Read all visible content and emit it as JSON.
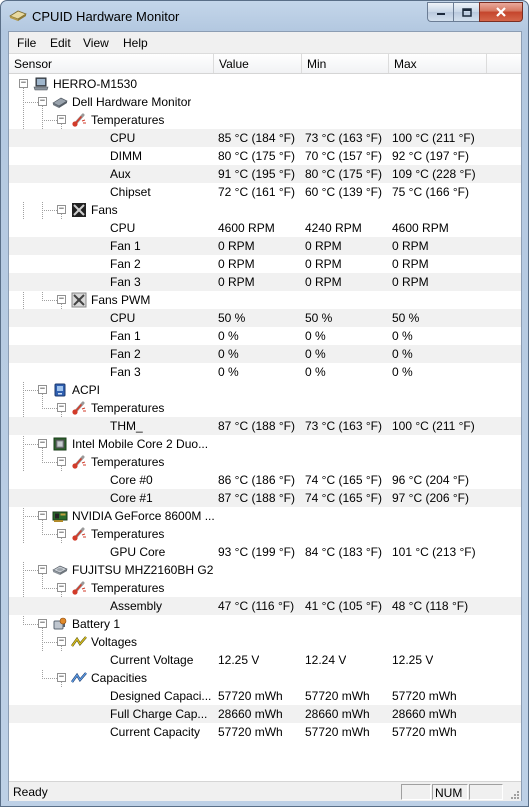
{
  "window": {
    "title": "CPUID Hardware Monitor"
  },
  "menu": [
    {
      "label": "File"
    },
    {
      "label": "Edit"
    },
    {
      "label": "View"
    },
    {
      "label": "Help"
    }
  ],
  "columns": [
    {
      "label": "Sensor"
    },
    {
      "label": "Value"
    },
    {
      "label": "Min"
    },
    {
      "label": "Max"
    }
  ],
  "rows": [
    {
      "level": 0,
      "expander": "−",
      "icon": "laptop-icon",
      "name": "HERRO-M1530"
    },
    {
      "level": 1,
      "expander": "−",
      "icon": "chip-icon",
      "name": "Dell Hardware Monitor"
    },
    {
      "level": 2,
      "expander": "−",
      "icon": "thermometer-icon",
      "name": "Temperatures"
    },
    {
      "level": 3,
      "name": "CPU",
      "value": "85 °C  (184 °F)",
      "min": "73 °C  (163 °F)",
      "max": "100 °C  (211 °F)"
    },
    {
      "level": 3,
      "name": "DIMM",
      "value": "80 °C  (175 °F)",
      "min": "70 °C  (157 °F)",
      "max": "92 °C  (197 °F)"
    },
    {
      "level": 3,
      "name": "Aux",
      "value": "91 °C  (195 °F)",
      "min": "80 °C  (175 °F)",
      "max": "109 °C  (228 °F)"
    },
    {
      "level": 3,
      "name": "Chipset",
      "value": "72 °C  (161 °F)",
      "min": "60 °C  (139 °F)",
      "max": "75 °C  (166 °F)"
    },
    {
      "level": 2,
      "expander": "−",
      "icon": "fan-icon",
      "name": "Fans"
    },
    {
      "level": 3,
      "name": "CPU",
      "value": "4600 RPM",
      "min": "4240 RPM",
      "max": "4600 RPM"
    },
    {
      "level": 3,
      "name": "Fan 1",
      "value": "0 RPM",
      "min": "0 RPM",
      "max": "0 RPM"
    },
    {
      "level": 3,
      "name": "Fan 2",
      "value": "0 RPM",
      "min": "0 RPM",
      "max": "0 RPM"
    },
    {
      "level": 3,
      "name": "Fan 3",
      "value": "0 RPM",
      "min": "0 RPM",
      "max": "0 RPM"
    },
    {
      "level": 2,
      "expander": "−",
      "icon": "fan-pwm-icon",
      "name": "Fans PWM"
    },
    {
      "level": 3,
      "name": "CPU",
      "value": "50 %",
      "min": "50 %",
      "max": "50 %"
    },
    {
      "level": 3,
      "name": "Fan 1",
      "value": "0 %",
      "min": "0 %",
      "max": "0 %"
    },
    {
      "level": 3,
      "name": "Fan 2",
      "value": "0 %",
      "min": "0 %",
      "max": "0 %"
    },
    {
      "level": 3,
      "name": "Fan 3",
      "value": "0 %",
      "min": "0 %",
      "max": "0 %"
    },
    {
      "level": 1,
      "expander": "−",
      "icon": "acpi-icon",
      "name": "ACPI"
    },
    {
      "level": 2,
      "expander": "−",
      "icon": "thermometer-icon",
      "name": "Temperatures"
    },
    {
      "level": 3,
      "name": "THM_",
      "value": "87 °C  (188 °F)",
      "min": "73 °C  (163 °F)",
      "max": "100 °C  (211 °F)"
    },
    {
      "level": 1,
      "expander": "−",
      "icon": "cpu-icon",
      "name": "Intel Mobile Core 2 Duo..."
    },
    {
      "level": 2,
      "expander": "−",
      "icon": "thermometer-icon",
      "name": "Temperatures"
    },
    {
      "level": 3,
      "name": "Core #0",
      "value": "86 °C  (186 °F)",
      "min": "74 °C  (165 °F)",
      "max": "96 °C  (204 °F)"
    },
    {
      "level": 3,
      "name": "Core #1",
      "value": "87 °C  (188 °F)",
      "min": "74 °C  (165 °F)",
      "max": "97 °C  (206 °F)"
    },
    {
      "level": 1,
      "expander": "−",
      "icon": "gpu-icon",
      "name": "NVIDIA GeForce 8600M ..."
    },
    {
      "level": 2,
      "expander": "−",
      "icon": "thermometer-icon",
      "name": "Temperatures"
    },
    {
      "level": 3,
      "name": "GPU Core",
      "value": "93 °C  (199 °F)",
      "min": "84 °C  (183 °F)",
      "max": "101 °C  (213 °F)"
    },
    {
      "level": 1,
      "expander": "−",
      "icon": "hard-drive-icon",
      "name": "FUJITSU MHZ2160BH G2"
    },
    {
      "level": 2,
      "expander": "−",
      "icon": "thermometer-icon",
      "name": "Temperatures"
    },
    {
      "level": 3,
      "name": "Assembly",
      "value": "47 °C  (116 °F)",
      "min": "41 °C  (105 °F)",
      "max": "48 °C  (118 °F)"
    },
    {
      "level": 1,
      "expander": "−",
      "icon": "battery-icon",
      "name": "Battery 1"
    },
    {
      "level": 2,
      "expander": "−",
      "icon": "voltage-icon",
      "name": "Voltages"
    },
    {
      "level": 3,
      "name": "Current Voltage",
      "value": "12.25 V",
      "min": "12.24 V",
      "max": "12.25 V"
    },
    {
      "level": 2,
      "expander": "−",
      "icon": "capacity-icon",
      "name": "Capacities"
    },
    {
      "level": 3,
      "name": "Designed Capaci...",
      "value": "57720 mWh",
      "min": "57720 mWh",
      "max": "57720 mWh"
    },
    {
      "level": 3,
      "name": "Full Charge Cap...",
      "value": "28660 mWh",
      "min": "28660 mWh",
      "max": "28660 mWh"
    },
    {
      "level": 3,
      "name": "Current Capacity",
      "value": "57720 mWh",
      "min": "57720 mWh",
      "max": "57720 mWh"
    }
  ],
  "status": {
    "text": "Ready",
    "num": "NUM"
  }
}
